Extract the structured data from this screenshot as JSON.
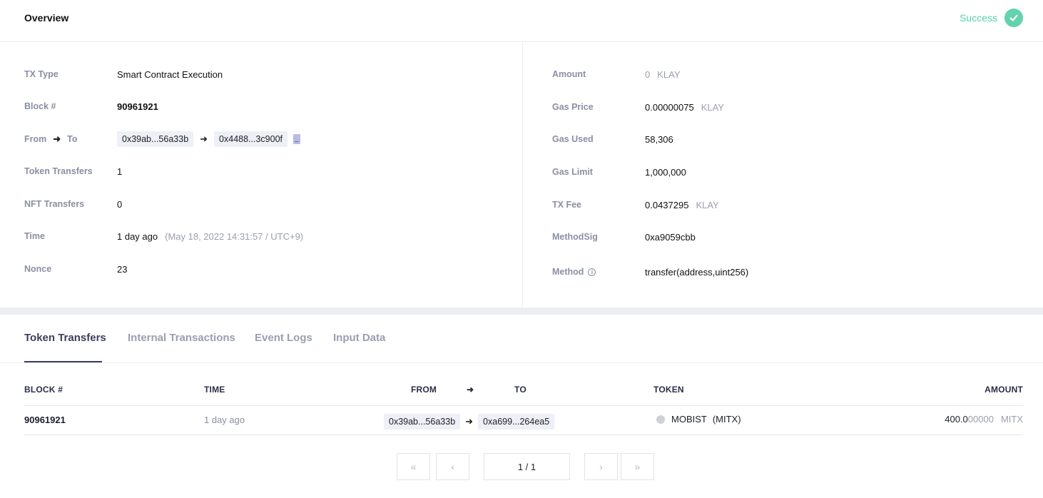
{
  "header": {
    "title": "Overview",
    "status": "Success",
    "status_color": "#63d3ad"
  },
  "overview_left": {
    "tx_type": {
      "label": "TX Type",
      "value": "Smart Contract Execution"
    },
    "block": {
      "label": "Block #",
      "value": "90961921"
    },
    "from_to": {
      "label_from": "From",
      "label_to": "To",
      "from": "0x39ab...56a33b",
      "to": "0x4488...3c900f"
    },
    "token_transfers": {
      "label": "Token Transfers",
      "value": "1"
    },
    "nft_transfers": {
      "label": "NFT Transfers",
      "value": "0"
    },
    "time": {
      "label": "Time",
      "value": "1 day ago",
      "detail": "(May 18, 2022 14:31:57 / UTC+9)"
    },
    "nonce": {
      "label": "Nonce",
      "value": "23"
    }
  },
  "overview_right": {
    "amount": {
      "label": "Amount",
      "value": "0",
      "unit": "KLAY"
    },
    "gas_price": {
      "label": "Gas Price",
      "value": "0.00000075",
      "unit": "KLAY"
    },
    "gas_used": {
      "label": "Gas Used",
      "value": "58,306"
    },
    "gas_limit": {
      "label": "Gas Limit",
      "value": "1,000,000"
    },
    "tx_fee": {
      "label": "TX Fee",
      "value": "0.0437295",
      "unit": "KLAY"
    },
    "method_sig": {
      "label": "MethodSig",
      "value": "0xa9059cbb"
    },
    "method": {
      "label": "Method",
      "value": "transfer(address,uint256)"
    }
  },
  "tabs": [
    {
      "label": "Token Transfers",
      "active": true
    },
    {
      "label": "Internal Transactions",
      "active": false
    },
    {
      "label": "Event Logs",
      "active": false
    },
    {
      "label": "Input Data",
      "active": false
    }
  ],
  "table": {
    "headers": {
      "block": "BLOCK #",
      "time": "TIME",
      "from": "FROM",
      "to": "TO",
      "token": "TOKEN",
      "amount": "AMOUNT"
    },
    "rows": [
      {
        "block": "90961921",
        "time": "1 day ago",
        "from": "0x39ab...56a33b",
        "to": "0xa699...264ea5",
        "token_name": "MOBIST",
        "token_symbol": "(MITX)",
        "amount_main": "400.0",
        "amount_dim": "00000",
        "amount_unit": "MITX"
      }
    ]
  },
  "pagination": {
    "page": "1 / 1",
    "first_icon": "double-chevron-left-icon",
    "prev_icon": "chevron-left-icon",
    "next_icon": "chevron-right-icon",
    "last_icon": "double-chevron-right-icon"
  }
}
